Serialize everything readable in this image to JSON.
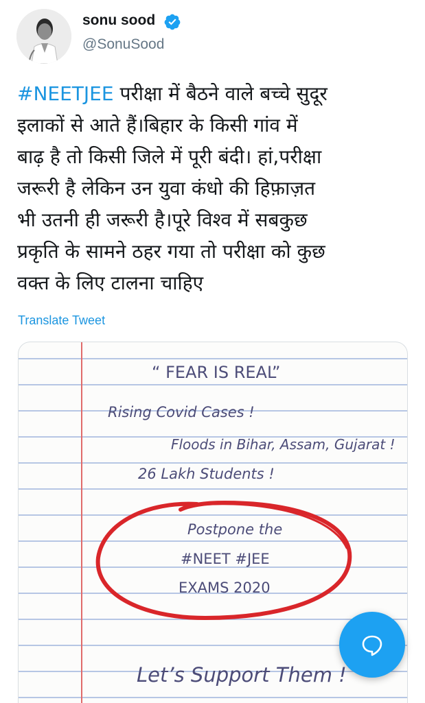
{
  "tweet": {
    "author": {
      "display_name": "sonu sood",
      "handle": "@SonuSood",
      "verified": true,
      "avatar_icon": "profile-photo"
    },
    "hashtag": "#NEETJEE",
    "body_lines": [
      " परीक्षा में बैठने वाले बच्चे सुदूर",
      "इलाकों से आते हैं।बिहार के किसी गांव में",
      "बाढ़ है तो किसी जिले में पूरी बंदी। हां,परीक्षा",
      "जरूरी है लेकिन उन युवा कंधो की हिफ़ाज़त",
      "भी उतनी ही जरूरी है।पूरे विश्व में सबकुछ",
      "प्रकृति के सामने ठहर गया तो परीक्षा को कुछ",
      "वक्त के लिए टालना चाहिए"
    ],
    "translate_label": "Translate Tweet"
  },
  "media": {
    "title": "“ FEAR IS REAL”",
    "line1": "Rising Covid Cases !",
    "line2": "Floods in Bihar, Assam, Gujarat !",
    "line3": "26 Lakh Students !",
    "circled_1": "Postpone the",
    "circled_2": "#NEET   #JEE",
    "circled_3": "EXAMS 2020",
    "footer": "Let’s Support Them !"
  },
  "compose_fab": {
    "icon": "compose-reply-icon"
  },
  "colors": {
    "link_blue": "#1b95e0",
    "fab_blue": "#1da1f2",
    "paper_line_blue": "#9fb4dc",
    "margin_red": "#e06a6a",
    "circle_red": "#d9262a",
    "ink": "#4c4c78"
  }
}
